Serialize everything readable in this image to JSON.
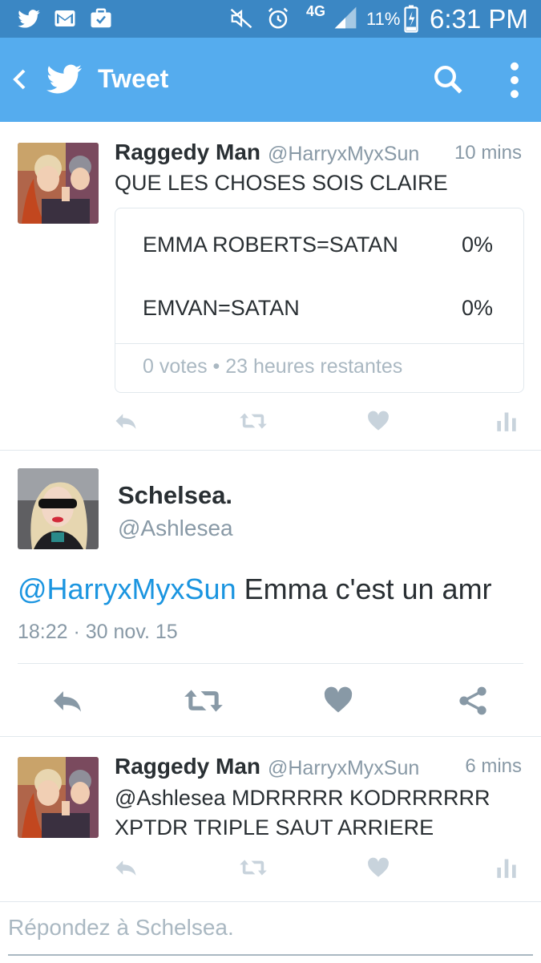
{
  "status_bar": {
    "icons": [
      "twitter-icon",
      "gmail-icon",
      "briefcase-icon",
      "mute-icon",
      "alarm-icon",
      "signal-icon",
      "battery-icon"
    ],
    "network": "4G",
    "battery": "11%",
    "time": "6:31 PM"
  },
  "app_bar": {
    "title": "Tweet",
    "icons": [
      "back-icon",
      "twitter-logo-icon",
      "search-icon",
      "more-icon"
    ],
    "color": "#55acee"
  },
  "tweet1": {
    "name": "Raggedy Man",
    "handle": "@HarryxMyxSun",
    "time": "10 mins",
    "text": "QUE LES CHOSES SOIS CLAIRE",
    "poll": {
      "options": [
        {
          "label": "EMMA ROBERTS=SATAN",
          "percent": "0%"
        },
        {
          "label": "EMVAN=SATAN",
          "percent": "0%"
        }
      ],
      "footer": "0 votes • 23 heures restantes"
    }
  },
  "tweet2": {
    "name": "Schelsea.",
    "handle": "@Ashlesea",
    "mention": "@HarryxMyxSun",
    "text": " Emma c'est un amr",
    "timestamp": "18:22 · 30 nov. 15"
  },
  "tweet3": {
    "name": "Raggedy Man",
    "handle": "@HarryxMyxSun",
    "time": "6 mins",
    "line1": "@Ashlesea MDRRRRR KODRRRRRR",
    "line2": "XPTDR TRIPLE SAUT ARRIERE"
  },
  "reply_box": {
    "placeholder": "Répondez à Schelsea."
  },
  "colors": {
    "accent": "#55acee",
    "status_bar": "#3b87c4",
    "link": "#1b95e0",
    "muted": "#8899a6",
    "action": "#a9b7c3"
  }
}
